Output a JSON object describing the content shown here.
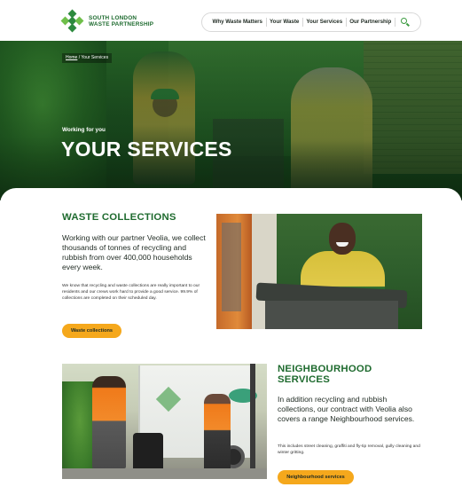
{
  "header": {
    "logo_line1": "SOUTH LONDON",
    "logo_line2": "WASTE PARTNERSHIP",
    "logo_icon": "diamond-cluster-icon",
    "nav": [
      "Why Waste Matters",
      "Your Waste",
      "Your Services",
      "Our Partnership"
    ],
    "search_icon": "search-icon"
  },
  "hero": {
    "breadcrumb_home": "Home",
    "breadcrumb_sep": " / ",
    "breadcrumb_current": "Your Services",
    "eyebrow": "Working for you",
    "title": "YOUR SERVICES"
  },
  "section1": {
    "title": "WASTE COLLECTIONS",
    "lead": "Working with our partner Veolia, we collect thousands of tonnes of recycling and rubbish from over 400,000 households every week.",
    "body": "We know that recycling and waste collections are really important to our residents and our crews work hard to provide a good service. 99.9% of collections are completed on their scheduled day.",
    "button": "Waste collections"
  },
  "section2": {
    "title": "NEIGHBOURHOOD SERVICES",
    "lead": "In addition recycling and rubbish collections, our contract with Veolia also covers a range Neighbourhood services.",
    "body": "This includes street cleaning, graffiti and fly-tip removal, gully cleaning and winter gritting.",
    "button": "Neighbourhood services"
  },
  "colors": {
    "brand_green": "#1f6b2f",
    "accent_orange": "#f5a81c",
    "search_green": "#3a9a3f"
  }
}
